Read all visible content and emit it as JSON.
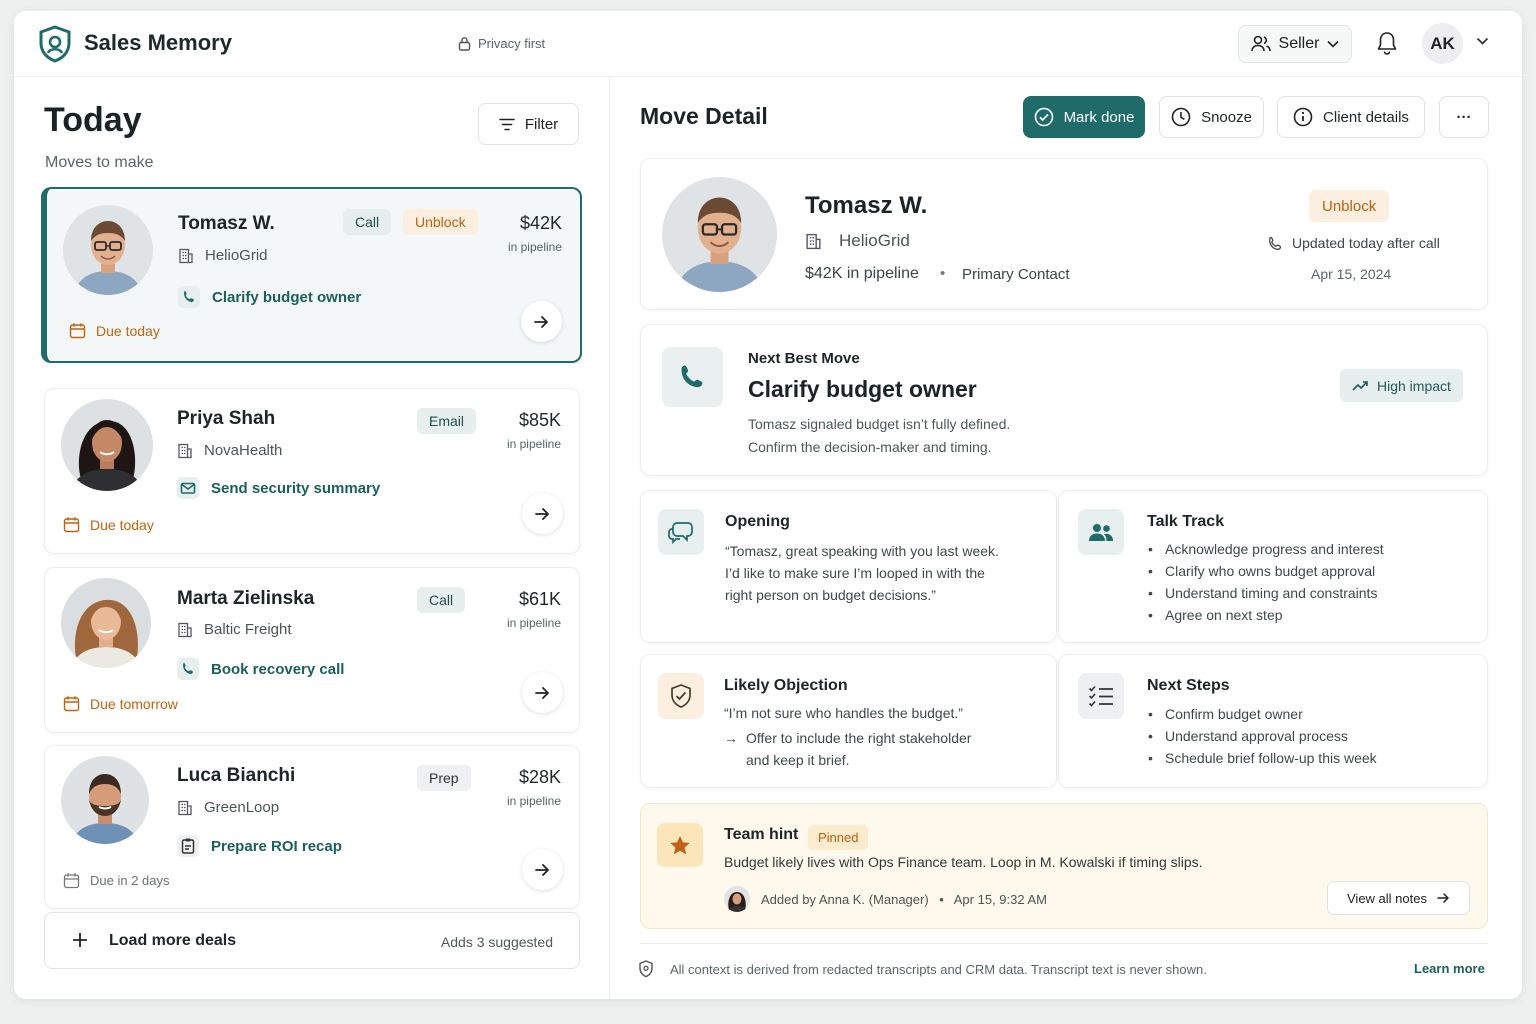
{
  "app": {
    "name": "Sales Memory",
    "privacy": "Privacy first",
    "role": "Seller",
    "user_initials": "AK"
  },
  "today": {
    "title": "Today",
    "subtitle": "Moves to make",
    "filter_label": "Filter",
    "deals": [
      {
        "name": "Tomasz W.",
        "company": "HelioGrid",
        "tags": [
          "Call",
          "Unblock"
        ],
        "amount": "$42K",
        "pipeline": "in pipeline",
        "move": "Clarify budget owner",
        "move_icon": "phone-icon",
        "due": "Due today"
      },
      {
        "name": "Priya Shah",
        "company": "NovaHealth",
        "tags": [
          "Email"
        ],
        "amount": "$85K",
        "pipeline": "in pipeline",
        "move": "Send security summary",
        "move_icon": "mail-icon",
        "due": "Due today"
      },
      {
        "name": "Marta Zielinska",
        "company": "Baltic Freight",
        "tags": [
          "Call"
        ],
        "amount": "$61K",
        "pipeline": "in pipeline",
        "move": "Book recovery call",
        "move_icon": "phone-icon",
        "due": "Due tomorrow"
      },
      {
        "name": "Luca Bianchi",
        "company": "GreenLoop",
        "tags": [
          "Prep"
        ],
        "amount": "$28K",
        "pipeline": "in pipeline",
        "move": "Prepare ROI recap",
        "move_icon": "clipboard-icon",
        "due": "Due in 2 days"
      }
    ],
    "load_more": {
      "label": "Load more deals",
      "note": "Adds 3 suggested"
    }
  },
  "detail": {
    "title": "Move Detail",
    "actions": {
      "mark_done": "Mark done",
      "snooze": "Snooze",
      "client_details": "Client details",
      "more": "···"
    },
    "contact": {
      "name": "Tomasz W.",
      "company": "HelioGrid",
      "pipeline": "$42K in pipeline",
      "separator": "•",
      "role": "Primary Contact",
      "status": "Unblock",
      "updated": "Updated today after call",
      "date": "Apr 15, 2024"
    },
    "next_best_move": {
      "label": "Next Best Move",
      "title": "Clarify budget owner",
      "desc1": "Tomasz signaled budget isn’t fully defined.",
      "desc2": "Confirm the decision-maker and timing.",
      "impact": "High impact"
    },
    "opening": {
      "title": "Opening",
      "lines": [
        "“Tomasz, great speaking with you last week.",
        "I’d like to make sure I’m looped in with the",
        "right person on budget decisions.”"
      ]
    },
    "talk_track": {
      "title": "Talk Track",
      "items": [
        "Acknowledge progress and interest",
        "Clarify who owns budget approval",
        "Understand timing and constraints",
        "Agree on next step"
      ]
    },
    "objection": {
      "title": "Likely Objection",
      "quote": "“I’m not sure who handles the budget.”",
      "answer_arrow": "→",
      "answer1": "Offer to include the right stakeholder",
      "answer2": "and keep it brief."
    },
    "next_steps": {
      "title": "Next Steps",
      "items": [
        "Confirm budget owner",
        "Understand approval process",
        "Schedule brief follow-up this week"
      ]
    },
    "team_hint": {
      "title": "Team hint",
      "badge": "Pinned",
      "text": "Budget likely lives with Ops Finance team. Loop in M. Kowalski if timing slips.",
      "author": "Added by Anna K. (Manager)",
      "separator": "•",
      "time": "Apr 15, 9:32 AM",
      "view_notes": "View all notes"
    },
    "footer": {
      "text": "All context is derived from redacted transcripts and CRM data. Transcript text is never shown.",
      "learn_more": "Learn more"
    }
  },
  "colors": {
    "accent": "#1e6b6a",
    "warning": "#c0610e",
    "unblock_bg": "#fcefe0",
    "hint_bg": "#fef9ec"
  }
}
